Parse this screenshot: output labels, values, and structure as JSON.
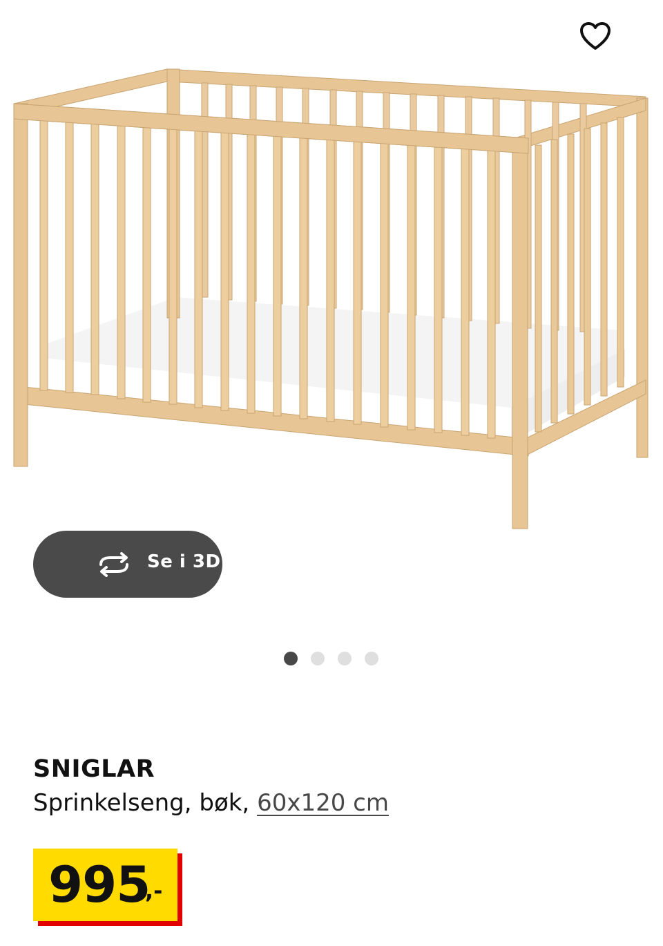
{
  "product_image": {
    "alt": "",
    "favorite_icon": "heart-outline-icon",
    "view_3d": {
      "label": "Se i 3D",
      "icon": "rotate-arrows-icon"
    },
    "carousel": {
      "total": 4,
      "active": 1
    }
  },
  "product": {
    "name": "SNIGLAR",
    "description": "Sprinkelseng, bøk,",
    "size_link": "60x120 cm"
  },
  "price": {
    "integer": "995",
    "decimal": ",-",
    "highlight_color": "#ffdb00",
    "shadow_color": "#e00000"
  },
  "colors": {
    "wood": "#e8c898",
    "mattress": "#ffffff",
    "button_bg": "#4a4a4a",
    "dot_active": "#484848",
    "dot_inactive": "#dfdfdf"
  }
}
